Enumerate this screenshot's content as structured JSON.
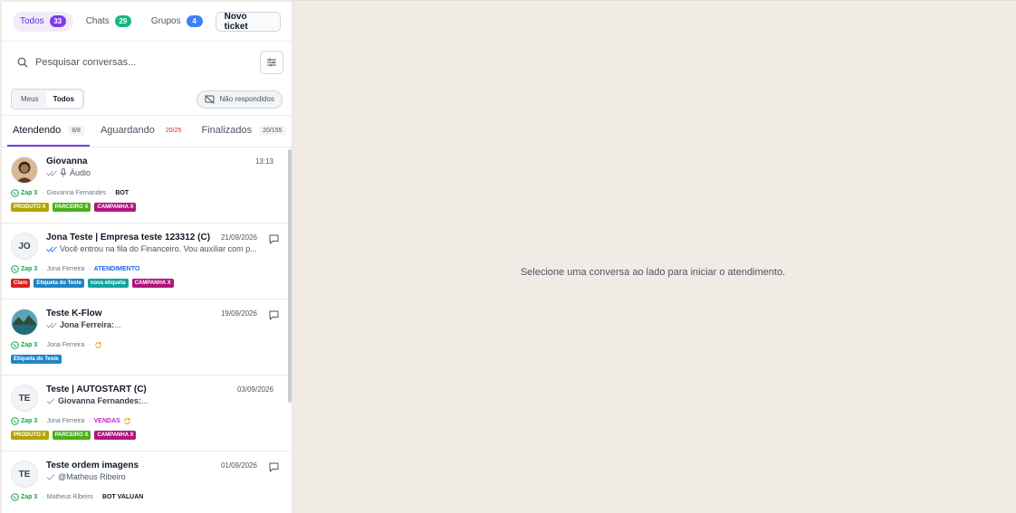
{
  "filters": {
    "items": [
      {
        "label": "Todos",
        "count": "33",
        "color": "#7c3aed"
      },
      {
        "label": "Chats",
        "count": "29",
        "color": "#10b981"
      },
      {
        "label": "Grupos",
        "count": "4",
        "color": "#3b82f6"
      }
    ],
    "new_ticket_label": "Novo ticket"
  },
  "search": {
    "placeholder": "Pesquisar conversas..."
  },
  "scope": {
    "meus": "Meus",
    "todos": "Todos",
    "nao_respondidos": "Não respondidos"
  },
  "tabs": [
    {
      "label": "Atendendo",
      "count": "8/8"
    },
    {
      "label": "Aguardando",
      "count": "20/25"
    },
    {
      "label": "Finalizados",
      "count": "20/155"
    }
  ],
  "conversations": [
    {
      "name": "Giovanna",
      "time": "13:13",
      "avatar": "",
      "preview": "Áudio",
      "channel": "Zap 3",
      "agent": "Giovanna Fernandes",
      "tag": "BOT",
      "labels": [
        {
          "text": "PRODUTO X",
          "color": "#b5a400"
        },
        {
          "text": "PARCEIRO X",
          "color": "#4caf1a"
        },
        {
          "text": "CAMPANHA X",
          "color": "#b0157e"
        }
      ]
    },
    {
      "name": "Jona Teste | Empresa teste 123312 (C)",
      "time": "21/09/2026",
      "avatar": "JO",
      "preview": "Você entrou na fila do Financeiro. Vou auxiliar com p...",
      "channel": "Zap 3",
      "agent": "Jona Ferreira",
      "tag": "ATENDIMENTO",
      "labels": [
        {
          "text": "Claro",
          "color": "#dc1f1f"
        },
        {
          "text": "Etiqueta do Teste",
          "color": "#1f84c6"
        },
        {
          "text": "nova etiqueta",
          "color": "#0ea5a0"
        },
        {
          "text": "CAMPANHA X",
          "color": "#b0157e"
        }
      ]
    },
    {
      "name": "Teste K-Flow",
      "time": "19/09/2026",
      "avatar": "",
      "preview_sender": "Jona Ferreira:",
      "preview": "...",
      "channel": "Zap 3",
      "agent": "Jona Ferreira",
      "tag": "",
      "labels": [
        {
          "text": "Etiqueta do Teste",
          "color": "#1f84c6"
        }
      ]
    },
    {
      "name": "Teste | AUTOSTART (C)",
      "time": "03/09/2026",
      "avatar": "TE",
      "preview_sender": "Giovanna Fernandes:",
      "preview": "...",
      "channel": "Zap 3",
      "agent": "Jona Ferreira",
      "tag": "VENDAS",
      "labels": [
        {
          "text": "PRODUTO X",
          "color": "#b5a400"
        },
        {
          "text": "PARCEIRO X",
          "color": "#4caf1a"
        },
        {
          "text": "CAMPANHA X",
          "color": "#b0157e"
        }
      ]
    },
    {
      "name": "Teste ordem imagens",
      "time": "01/09/2026",
      "avatar": "TE",
      "preview": "@Matheus Ribeiro",
      "channel": "Zap 3",
      "agent": "Matheus Ribeiro",
      "tag": "BOT VALUAN",
      "labels": []
    }
  ],
  "main": {
    "empty_message": "Selecione uma conversa ao lado para iniciar o atendimento."
  },
  "colors": {
    "accent": "#7c3aed",
    "whatsapp": "#16a34a",
    "tag_atendimento": "#2563eb",
    "tag_vendas": "#c026d3",
    "sync_icon": "#f59e0b"
  }
}
